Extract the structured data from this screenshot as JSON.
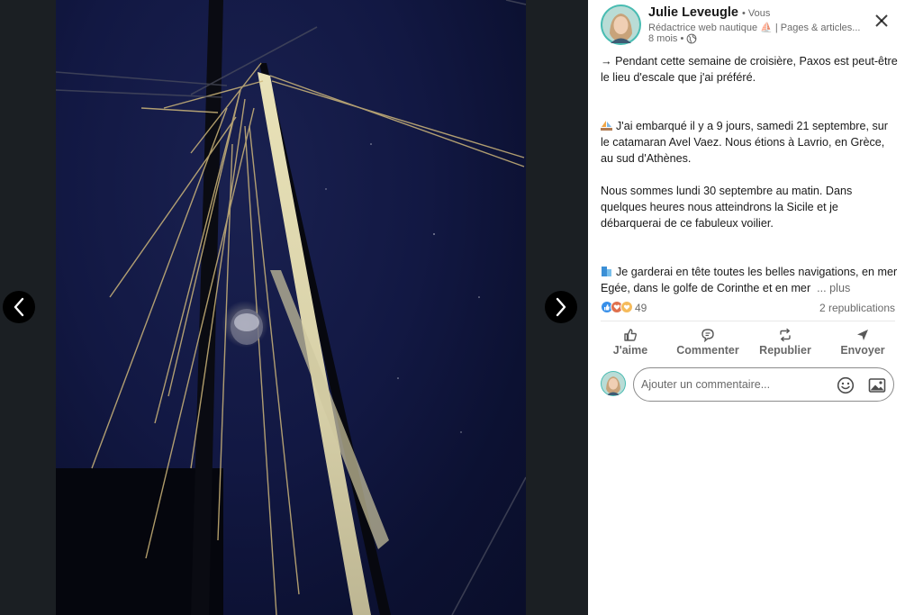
{
  "viewer": {
    "prev_icon": "chevron-left-icon",
    "next_icon": "chevron-right-icon",
    "photo_subject": "sailboat-mast-at-night"
  },
  "author": {
    "name": "Julie Leveugle",
    "relation": "• Vous",
    "headline": "Rédactrice web nautique ⛵ | Pages & articles...",
    "time": "8 mois •",
    "visibility_icon": "globe-icon"
  },
  "post": {
    "line_intro": "→ Pendant cette semaine de croisière, Paxos est peut-être le lieu d'escale que j'ai préféré.",
    "para_embark": "J'ai embarqué il y a 9 jours, samedi 21 septembre, sur le catamaran Avel Vaez. Nous étions à Lavrio, en Grèce, au sud d'Athènes.",
    "para_now": "Nous sommes lundi 30 septembre au matin. Dans quelques heures nous atteindrons la Sicile et je débarquerai de ce fabuleux voilier.",
    "para_memory": "Je garderai en tête toutes les belles navigations, en mer Egée, dans le golfe de Corinthe et en mer",
    "more": "... plus"
  },
  "social": {
    "reaction_count": "49",
    "reposts": "2 republications"
  },
  "actions": {
    "like": "J'aime",
    "comment": "Commenter",
    "repost": "Republier",
    "send": "Envoyer"
  },
  "comment": {
    "placeholder": "Ajouter un commentaire..."
  },
  "colors": {
    "accent": "#0a66c2",
    "avatar_ring": "#49bcb2",
    "viewer_bg": "#1b1f23",
    "sky": "#121843"
  }
}
